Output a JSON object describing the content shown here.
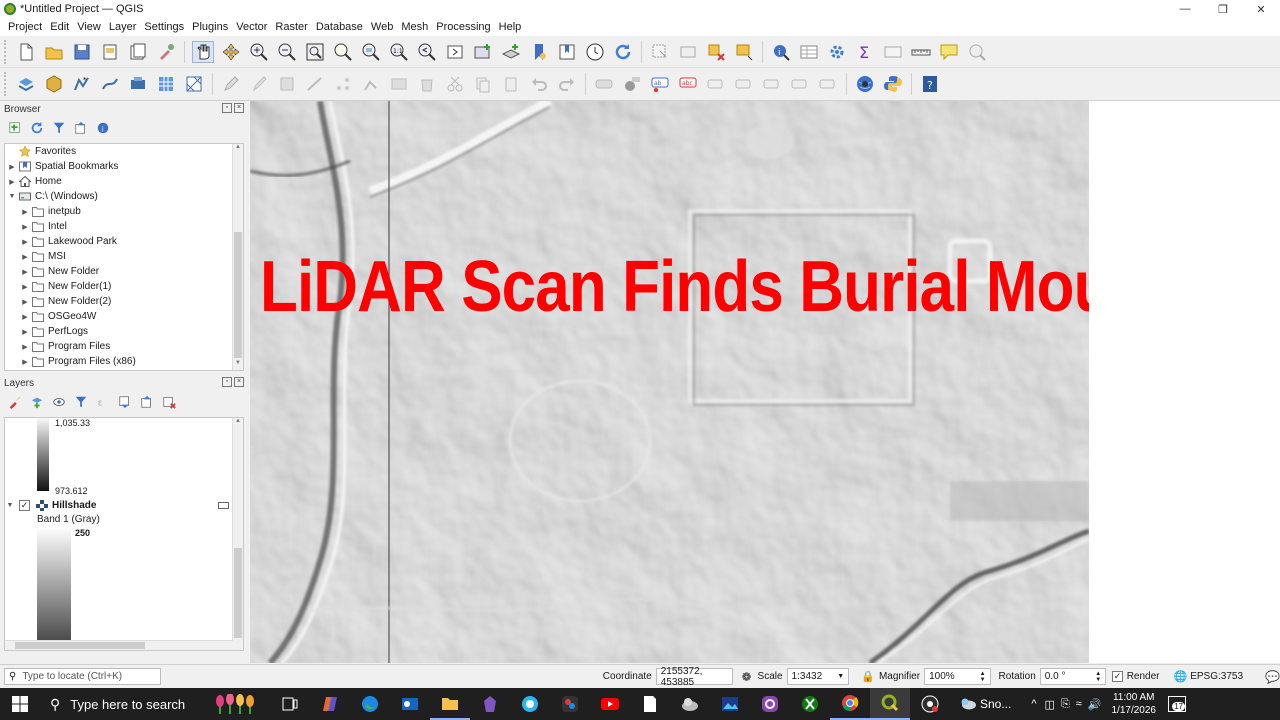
{
  "window": {
    "title": "*Untitled Project — QGIS",
    "minimize": "—",
    "maximize": "❐",
    "close": "✕"
  },
  "menu": [
    "Project",
    "Edit",
    "View",
    "Layer",
    "Settings",
    "Plugins",
    "Vector",
    "Raster",
    "Database",
    "Web",
    "Mesh",
    "Processing",
    "Help"
  ],
  "browser": {
    "title": "Browser",
    "items": [
      {
        "label": "Favorites",
        "indent": 0,
        "arrow": "",
        "icon": "star-icon"
      },
      {
        "label": "Spatial Bookmarks",
        "indent": 0,
        "arrow": "▶",
        "icon": "bookmark-icon"
      },
      {
        "label": "Home",
        "indent": 0,
        "arrow": "▶",
        "icon": "home-icon"
      },
      {
        "label": "C:\\ (Windows)",
        "indent": 0,
        "arrow": "▼",
        "icon": "drive-icon"
      },
      {
        "label": "inetpub",
        "indent": 1,
        "arrow": "▶",
        "icon": "folder-icon"
      },
      {
        "label": "Intel",
        "indent": 1,
        "arrow": "▶",
        "icon": "folder-icon"
      },
      {
        "label": "Lakewood Park",
        "indent": 1,
        "arrow": "▶",
        "icon": "folder-icon"
      },
      {
        "label": "MSI",
        "indent": 1,
        "arrow": "▶",
        "icon": "folder-icon"
      },
      {
        "label": "New Folder",
        "indent": 1,
        "arrow": "▶",
        "icon": "folder-icon"
      },
      {
        "label": "New Folder(1)",
        "indent": 1,
        "arrow": "▶",
        "icon": "folder-icon"
      },
      {
        "label": "New Folder(2)",
        "indent": 1,
        "arrow": "▶",
        "icon": "folder-icon"
      },
      {
        "label": "OSGeo4W",
        "indent": 1,
        "arrow": "▶",
        "icon": "folder-icon"
      },
      {
        "label": "PerfLogs",
        "indent": 1,
        "arrow": "▶",
        "icon": "folder-icon"
      },
      {
        "label": "Program Files",
        "indent": 1,
        "arrow": "▶",
        "icon": "folder-icon"
      },
      {
        "label": "Program Files (x86)",
        "indent": 1,
        "arrow": "▶",
        "icon": "folder-icon"
      }
    ]
  },
  "layers": {
    "title": "Layers",
    "dem_max": "1,035.33",
    "dem_min": "973.612",
    "hillshade": {
      "name": "Hillshade",
      "band": "Band 1 (Gray)",
      "max": "250"
    }
  },
  "map": {
    "headline": "LiDAR Scan Finds Burial Mounds"
  },
  "status": {
    "locator_placeholder": "Type to locate (Ctrl+K)",
    "coordinate_label": "Coordinate",
    "coordinate": "2155372, 453885",
    "scale_label": "Scale",
    "scale": "1:3432",
    "magnifier_label": "Magnifier",
    "magnifier": "100%",
    "rotation_label": "Rotation",
    "rotation": "0.0 °",
    "render_label": "Render",
    "crs": "EPSG:3753"
  },
  "taskbar": {
    "search_placeholder": "Type here to search",
    "weather": "Sno...",
    "time": "11:00 AM",
    "date": "1/17/2026",
    "notifications": "17"
  }
}
